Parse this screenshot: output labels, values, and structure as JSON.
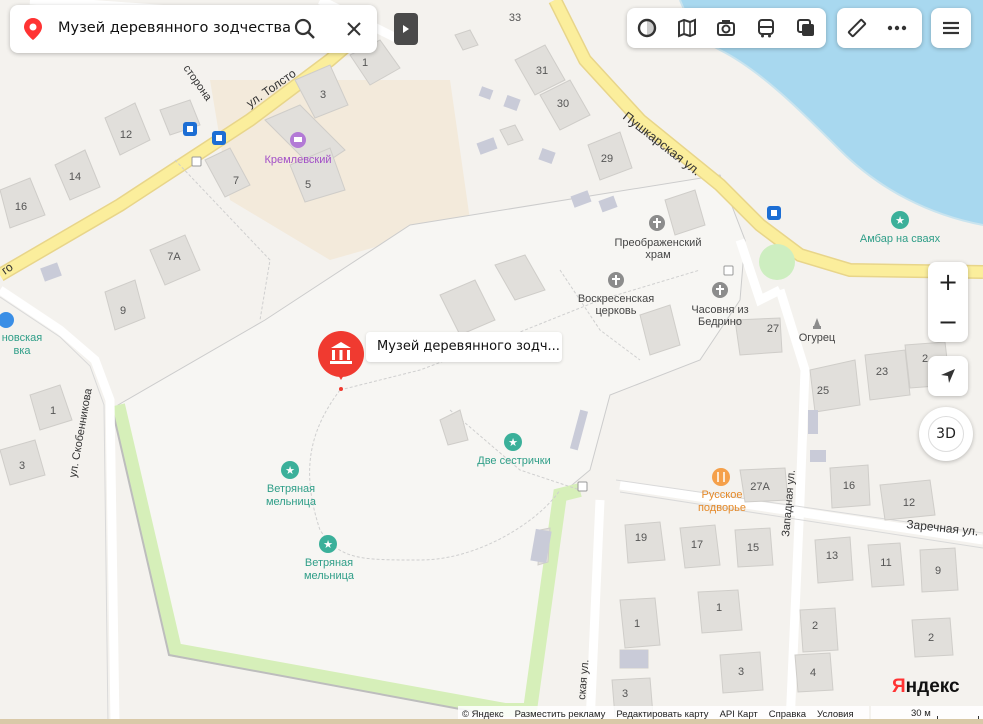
{
  "search": {
    "query": "Музей деревянного зодчества"
  },
  "popup": {
    "label": "Музей деревянного зодч..."
  },
  "zoom": {
    "in": "+",
    "out": "−"
  },
  "btn3d": {
    "label": "3D"
  },
  "brand": {
    "ya": "Я",
    "ndex": "ндекс"
  },
  "footer": {
    "copyright": "© Яндекс",
    "ads": "Разместить рекламу",
    "edit": "Редактировать карту",
    "api": "API Карт",
    "help": "Справка",
    "terms": "Условия"
  },
  "scale": {
    "label": "30 м"
  },
  "streets": {
    "tolstogo": "ул. Толсто",
    "storona": "сторона",
    "pushkarskaya": "Пушкарская ул.",
    "skobennikova": "ул. Скобенникова",
    "zapadnaya": "Западная ул.",
    "zarechnaya": "Заречная ул.",
    "sk": "ская ул.",
    "go": "го"
  },
  "pois": {
    "kremlevsky": "Кремлевский",
    "preobrazhensky1": "Преображенский",
    "preobrazhensky2": "храм",
    "voskresenskaya1": "Воскресенская",
    "voskresenskaya2": "церковь",
    "chasovnya1": "Часовня из",
    "chasovnya2": "Бедрино",
    "ambar": "Амбар на сваях",
    "ogurets": "Огурец",
    "dve": "Две сестрички",
    "mill1a": "Ветряная",
    "mill1b": "мельница",
    "mill2a": "Ветряная",
    "mill2b": "мельница",
    "russkoe1": "Русское",
    "russkoe2": "подворье",
    "left1": "новская",
    "left2": "вка"
  },
  "houses": [
    "33",
    "1",
    "3",
    "31",
    "30",
    "12",
    "29",
    "14",
    "7",
    "5",
    "16",
    "7А",
    "9",
    "1",
    "3",
    "27",
    "25",
    "23",
    "2",
    "16",
    "27А",
    "12",
    "19",
    "17",
    "15",
    "13",
    "11",
    "9",
    "1",
    "1",
    "2",
    "2",
    "3",
    "4",
    "3"
  ],
  "colors": {
    "marker": "#f03a30",
    "poi": "#3bb09a",
    "food": "#f5a04a",
    "water": "#a8d8ef",
    "park": "#dff2c8"
  }
}
